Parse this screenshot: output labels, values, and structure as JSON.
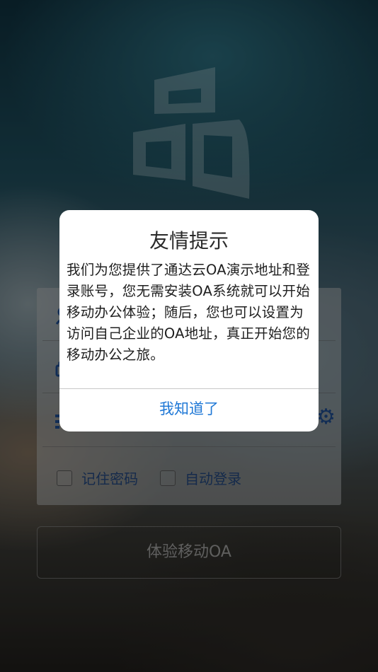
{
  "app": {
    "logo_icon": "oa-logo-icon"
  },
  "login": {
    "username_icon": "user-icon",
    "password_icon": "lock-icon",
    "server_icon": "server-list-icon",
    "settings_icon": "gear-icon",
    "remember_password_label": "记住密码",
    "auto_login_label": "自动登录",
    "remember_password_checked": false,
    "auto_login_checked": false,
    "try_button_label": "体验移动OA"
  },
  "dialog": {
    "title": "友情提示",
    "message": "我们为您提供了通达云OA演示地址和登录账号，您无需安装OA系统就可以开始移动办公体验；随后，您也可以设置为访问自己企业的OA地址，真正开始您的移动办公之旅。",
    "confirm_label": "我知道了"
  },
  "colors": {
    "accent": "#1f78d6",
    "icon_blue": "#1d4a8a"
  }
}
